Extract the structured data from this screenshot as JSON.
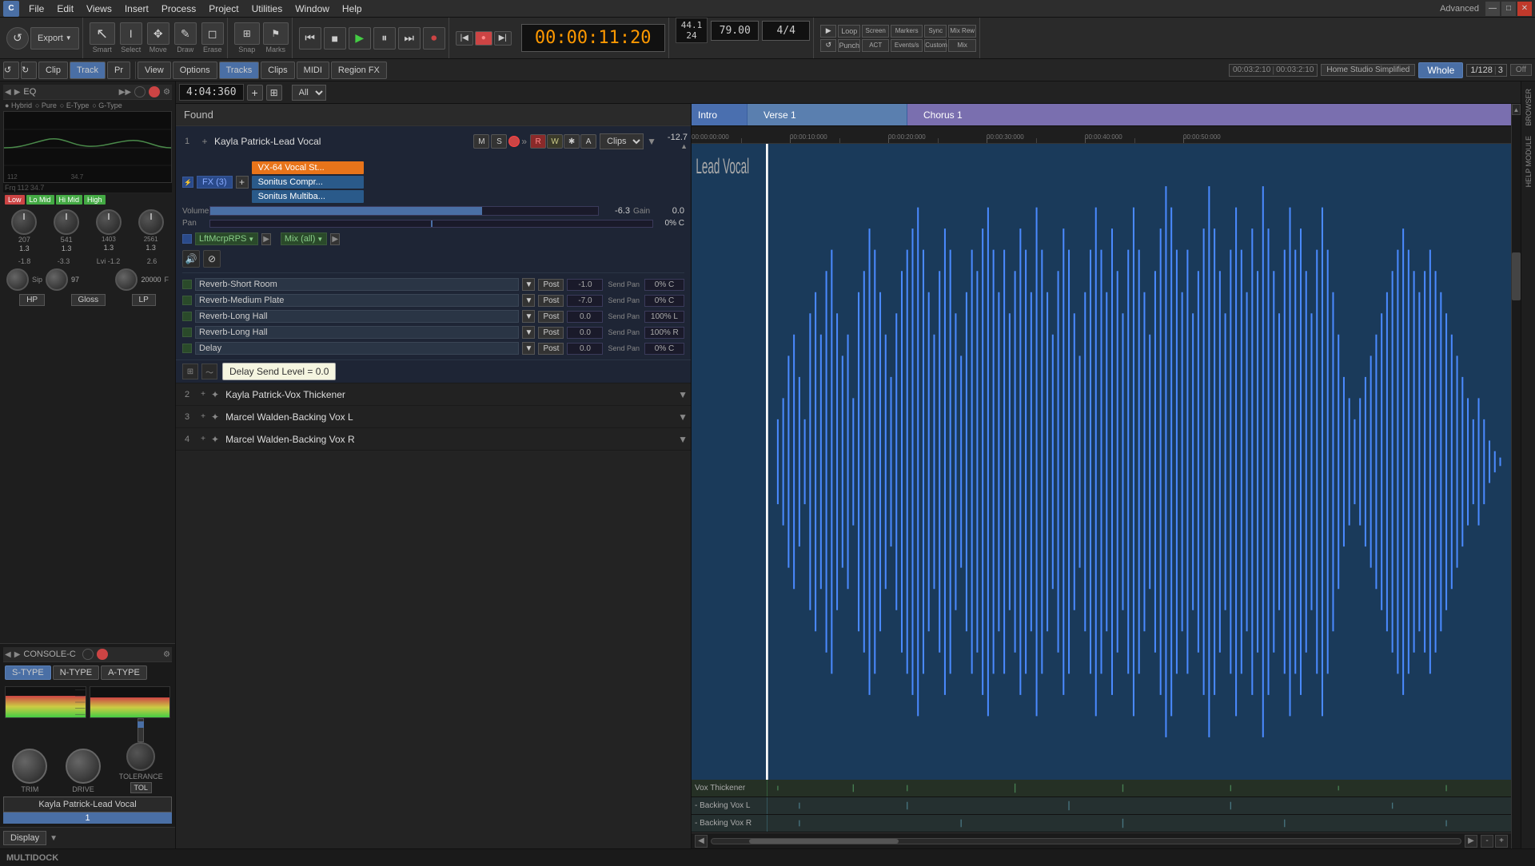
{
  "app": {
    "title": "Cakewalk",
    "mode": "Advanced"
  },
  "menu": {
    "items": [
      "File",
      "Edit",
      "Views",
      "Insert",
      "Process",
      "Project",
      "Utilities",
      "Window",
      "Help"
    ]
  },
  "toolbar": {
    "export_label": "Export",
    "smart_label": "Smart",
    "select_label": "Select",
    "move_label": "Move",
    "draw_label": "Draw",
    "erase_label": "Erase",
    "snap_label": "Snap",
    "marks_label": "Marks",
    "time": "00:00:11:20",
    "tempo": "79.00",
    "time_sig": "4/4",
    "measures": "44.1\n24",
    "snap_value": "1/128",
    "snap_count": "3",
    "mode_label": "Whole",
    "project_time": "00:03:2:10",
    "selection_time": "00:03:2:10",
    "studio_label": "Home Studio Simplified"
  },
  "tab_bar": {
    "tabs": [
      "View",
      "Options",
      "Tracks",
      "Clips",
      "MIDI",
      "Region FX"
    ]
  },
  "track_area": {
    "time_display": "4:04:360",
    "filter": "All",
    "found_label": "Found"
  },
  "tracks": [
    {
      "num": "1",
      "name": "Kayla Patrick-Lead Vocal",
      "db": "-12.7",
      "expanded": true,
      "volume": "-6.3",
      "gain": "0.0",
      "pan": "0% C",
      "bus": "LftMcrpRPS",
      "mix": "Mix (all)",
      "fx": [
        {
          "name": "VX-64 Vocal St...",
          "type": "orange"
        },
        {
          "name": "Sonitus Compr...",
          "type": "orange"
        },
        {
          "name": "Sonitus Multiba...",
          "type": "orange"
        }
      ],
      "fx_count": "FX (3)",
      "sends": [
        {
          "name": "Reverb-Short Room",
          "level": "-1.0",
          "pan": "0% C"
        },
        {
          "name": "Reverb-Medium Plate",
          "level": "-7.0",
          "pan": "0% C"
        },
        {
          "name": "Reverb-Long Hall",
          "level": "0.0",
          "pan": "100% L"
        },
        {
          "name": "Reverb-Long Hall",
          "level": "0.0",
          "pan": "100% R"
        },
        {
          "name": "Delay",
          "level": "0.0",
          "pan": "0% C"
        }
      ],
      "tooltip": "Delay Send Level = 0.0"
    },
    {
      "num": "2",
      "name": "Kayla Patrick-Vox Thickener",
      "expanded": false
    },
    {
      "num": "3",
      "name": "Marcel Walden-Backing Vox L",
      "expanded": false
    },
    {
      "num": "4",
      "name": "Marcel Walden-Backing Vox R",
      "expanded": false
    }
  ],
  "timeline": {
    "sections": [
      {
        "label": "Intro",
        "type": "intro"
      },
      {
        "label": "Verse 1",
        "type": "verse"
      },
      {
        "label": "Chorus 1",
        "type": "chorus"
      }
    ],
    "small_tracks": [
      {
        "label": "Vox Thickener"
      },
      {
        "label": "- Backing Vox L"
      },
      {
        "label": "- Backing Vox R"
      }
    ]
  },
  "left_panel": {
    "eq_label": "EQ",
    "eq_type": "Hybrid",
    "knobs": [
      {
        "label": "207",
        "val": "1.3"
      },
      {
        "label": "541",
        "val": "1.3"
      },
      {
        "label": "1403",
        "val": "1.3"
      },
      {
        "label": "2561",
        "val": "1.3"
      }
    ],
    "band_vals": [
      {
        "label": "-1.8"
      },
      {
        "label": "-3.3"
      },
      {
        "label": "Lvi -1.2"
      },
      {
        "label": "2.6"
      }
    ],
    "extra_labels": [
      "Frq",
      "112",
      "34.7"
    ],
    "knob2_val": "97",
    "knob3_val": "20000",
    "hp_label": "HP",
    "gloss_label": "Gloss",
    "lp_label": "LP",
    "console_label": "CONSOLE-C",
    "type_btns": [
      "S-TYPE",
      "N-TYPE",
      "A-TYPE"
    ],
    "knob_labels": [
      "TRIM",
      "DRIVE",
      "TOLERANCE"
    ],
    "track_name": "Kayla Patrick-Lead Vocal",
    "track_num": "1",
    "display_label": "Display"
  },
  "bottom": {
    "label": "MULTIDOCK"
  },
  "right_tabs": [
    "BROWSER",
    "HELP MODULE"
  ]
}
